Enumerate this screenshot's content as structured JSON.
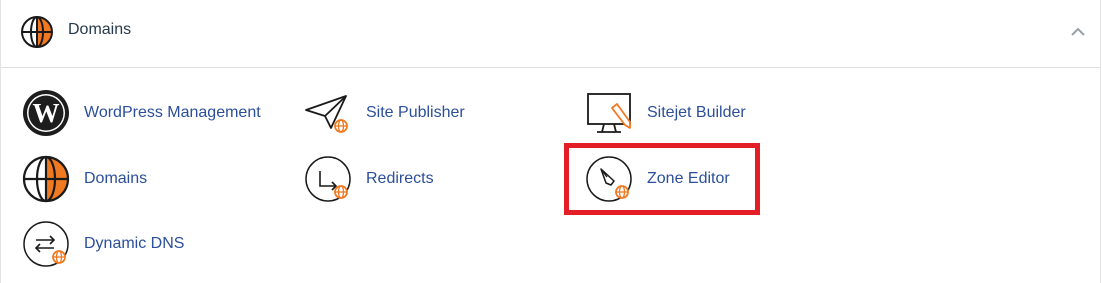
{
  "section": {
    "title": "Domains",
    "icon": "globe-icon",
    "collapse_icon": "chevron-up-icon"
  },
  "items": [
    {
      "label": "WordPress Management",
      "icon": "wordpress-icon"
    },
    {
      "label": "Site Publisher",
      "icon": "paper-plane-icon"
    },
    {
      "label": "Sitejet Builder",
      "icon": "monitor-pencil-icon"
    },
    {
      "label": "Domains",
      "icon": "globe-icon"
    },
    {
      "label": "Redirects",
      "icon": "redirect-arrow-icon"
    },
    {
      "label": "Zone Editor",
      "icon": "zone-editor-icon"
    },
    {
      "label": "Dynamic DNS",
      "icon": "swap-arrows-icon"
    }
  ],
  "colors": {
    "link": "#2b4f9a",
    "accent": "#f07a22",
    "highlight_border": "#e41e26"
  }
}
